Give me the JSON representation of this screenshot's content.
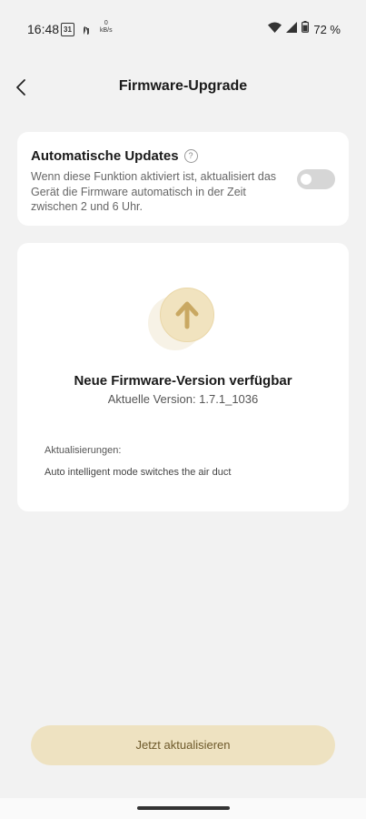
{
  "status_bar": {
    "time": "16:48",
    "calendar_day": "31",
    "net_speed_value": "0",
    "net_speed_unit": "kB/s",
    "battery": "72 %"
  },
  "header": {
    "title": "Firmware-Upgrade"
  },
  "auto_updates": {
    "title": "Automatische Updates",
    "help_glyph": "?",
    "description": "Wenn diese Funktion aktiviert ist, aktualisiert das Gerät die Firmware automatisch in der Zeit zwischen 2 und 6 Uhr.",
    "enabled": false
  },
  "firmware": {
    "title": "Neue Firmware-Version verfügbar",
    "current_version": "Aktuelle Version: 1.7.1_1036",
    "updates_label": "Aktualisierungen:",
    "updates_text": "Auto intelligent mode switches the air duct"
  },
  "action": {
    "update_button": "Jetzt aktualisieren"
  },
  "colors": {
    "accent": "#eee2c1",
    "accent_text": "#6e5a2b",
    "arrow": "#c9a862"
  }
}
